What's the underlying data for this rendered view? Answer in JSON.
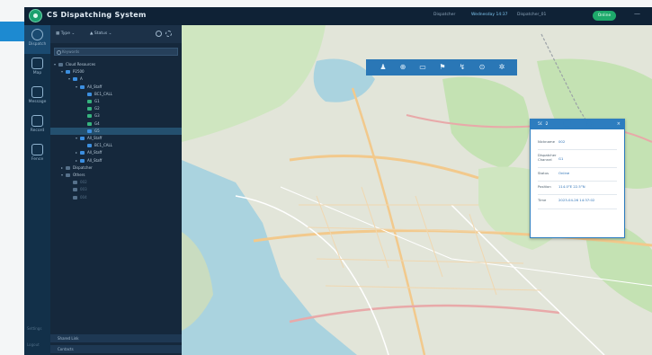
{
  "app": {
    "title": "CS Dispatching System",
    "user_label": "Dispatcher",
    "date_label": "Wednesday 14:37",
    "account_label": "Dispatcher_01",
    "status_badge": "Online",
    "minimize_glyph": "—",
    "accent_color": "#1d8ad1"
  },
  "nav": {
    "items": [
      {
        "label": "Dispatch",
        "icon": "headset-icon"
      },
      {
        "label": "Map",
        "icon": "map-icon"
      },
      {
        "label": "Message",
        "icon": "message-icon"
      },
      {
        "label": "Record",
        "icon": "record-icon"
      },
      {
        "label": "Fence",
        "icon": "fence-icon"
      }
    ],
    "bottom": [
      "Settings",
      "Logout"
    ]
  },
  "tree": {
    "toolbar": {
      "tab1": "Type",
      "tab2": "Status"
    },
    "search_placeholder": "Keywords",
    "rows": [
      {
        "text": "Cloud Resources",
        "icon": "gray",
        "arrow": "▾"
      },
      {
        "text": "P2500",
        "icon": "blue",
        "arrow": "▾"
      },
      {
        "text": "A",
        "icon": "blue",
        "arrow": "▾"
      },
      {
        "text": "All_Staff",
        "icon": "blue",
        "arrow": "▾"
      },
      {
        "text": "BC1_CALL",
        "icon": "blue",
        "arrow": ""
      },
      {
        "text": "G1",
        "icon": "green",
        "arrow": ""
      },
      {
        "text": "G2",
        "icon": "green",
        "arrow": ""
      },
      {
        "text": "G3",
        "icon": "green",
        "arrow": ""
      },
      {
        "text": "G4",
        "icon": "green",
        "arrow": ""
      },
      {
        "text": "G5",
        "icon": "blue",
        "arrow": "",
        "selected": true
      },
      {
        "text": "All_Staff",
        "icon": "blue",
        "arrow": "▾"
      },
      {
        "text": "BC1_CALL",
        "icon": "blue",
        "arrow": ""
      },
      {
        "text": "All_Staff",
        "icon": "blue",
        "arrow": "▸"
      },
      {
        "text": "All_Staff",
        "icon": "blue",
        "arrow": "▸"
      },
      {
        "text": "Dispatcher",
        "icon": "gray",
        "arrow": "▸"
      },
      {
        "text": "Others",
        "icon": "gray",
        "arrow": "▾"
      },
      {
        "text": "002",
        "icon": "gray",
        "arrow": "",
        "dim": true
      },
      {
        "text": "003",
        "icon": "gray",
        "arrow": "",
        "dim": true
      },
      {
        "text": "004",
        "icon": "gray",
        "arrow": "",
        "dim": true
      }
    ],
    "footer": [
      "Shared Link",
      "Contacts"
    ]
  },
  "map": {
    "toolbar_icons": [
      "person-icon",
      "locate-icon",
      "layer-icon",
      "flag-icon",
      "route-icon",
      "zoom-icon",
      "settings-icon"
    ],
    "popup": {
      "title": "5002",
      "close": "×",
      "fields": [
        {
          "label": "Nickname",
          "value": "002"
        },
        {
          "label": "Dispatcher Channel",
          "value": "G1"
        },
        {
          "label": "Status",
          "value": "Online"
        },
        {
          "label": "Position",
          "value": "114.0°E 22.5°N"
        },
        {
          "label": "Time",
          "value": "2023-04-26 14:37:02"
        }
      ],
      "actions": [
        "call-icon",
        "message-icon",
        "video-icon"
      ]
    }
  }
}
